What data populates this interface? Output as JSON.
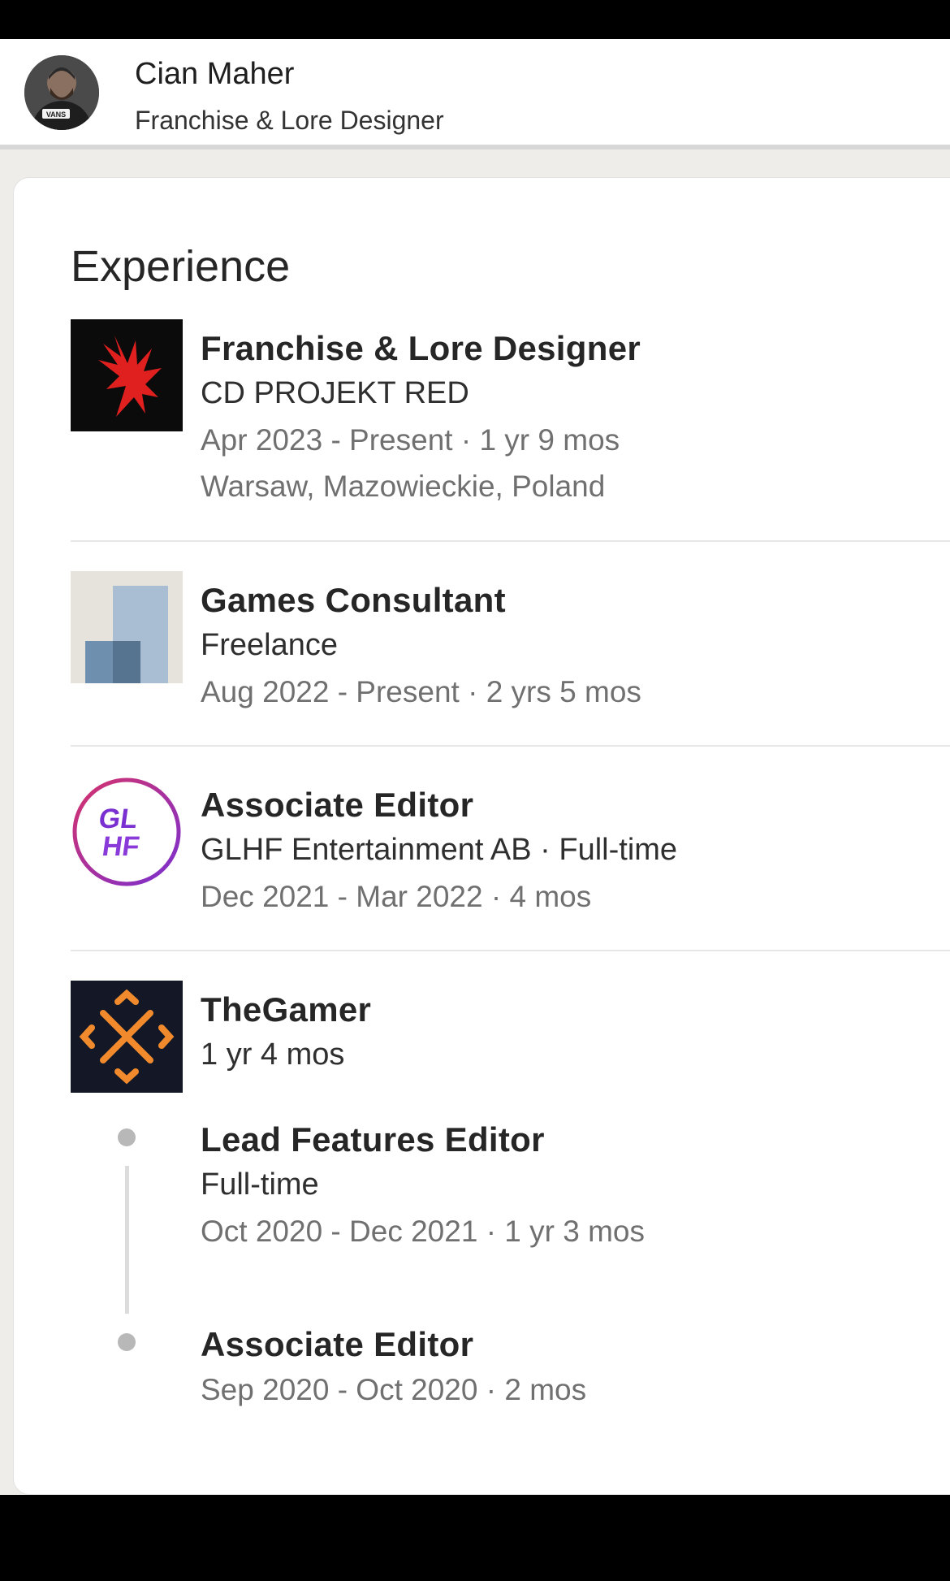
{
  "header": {
    "name": "Cian Maher",
    "headline": "Franchise & Lore Designer",
    "avatar_badge": "VANS"
  },
  "experience": {
    "title": "Experience",
    "items": [
      {
        "title": "Franchise & Lore Designer",
        "company": "CD PROJEKT RED",
        "dates": "Apr 2023 - Present · 1 yr 9 mos",
        "location": "Warsaw, Mazowieckie, Poland",
        "logo_icon": "cdpr-logo-icon"
      },
      {
        "title": "Games Consultant",
        "company": "Freelance",
        "dates": "Aug 2022 - Present · 2 yrs 5 mos",
        "logo_icon": "generic-company-logo-icon"
      },
      {
        "title": "Associate Editor",
        "company": "GLHF Entertainment AB · Full-time",
        "dates": "Dec 2021 - Mar 2022 · 4 mos",
        "logo_icon": "glhf-logo-icon",
        "logo_text": "GLHF"
      },
      {
        "company": "TheGamer",
        "duration": "1 yr 4 mos",
        "logo_icon": "thegamer-logo-icon",
        "roles": [
          {
            "title": "Lead Features Editor",
            "type": "Full-time",
            "dates": "Oct 2020 - Dec 2021 · 1 yr 3 mos"
          },
          {
            "title": "Associate Editor",
            "dates": "Sep 2020 - Oct 2020 · 2 mos"
          }
        ]
      }
    ]
  },
  "colors": {
    "cdpr_red": "#e0201f",
    "glhf_purple": "#7a2fd0",
    "glhf_pink": "#d6336c",
    "thegamer_orange": "#f08a2c"
  }
}
